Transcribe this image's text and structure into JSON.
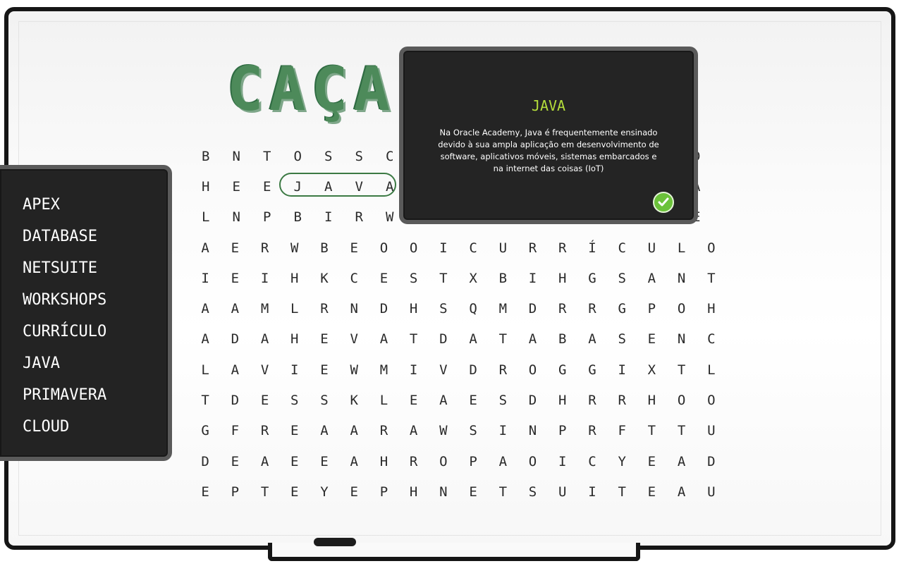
{
  "title": [
    "C",
    "A",
    "Ç",
    "A",
    "-"
  ],
  "menu": {
    "items": [
      {
        "label": "APEX"
      },
      {
        "label": "DATABASE"
      },
      {
        "label": "NETSUITE"
      },
      {
        "label": "WORKSHOPS"
      },
      {
        "label": "CURRÍCULO"
      },
      {
        "label": "JAVA"
      },
      {
        "label": "PRIMAVERA"
      },
      {
        "label": "CLOUD"
      }
    ]
  },
  "popup": {
    "title": "JAVA",
    "text": "Na Oracle Academy, Java é frequentemente ensinado devido à sua ampla aplicação em desenvolvimento de software, aplicativos móveis, sistemas embarcados e na internet das coisas (IoT)"
  },
  "grid": [
    [
      "B",
      "N",
      "T",
      "O",
      "S",
      "S",
      "C",
      "",
      "",
      "",
      "",
      "",
      "",
      "",
      "",
      "",
      "D"
    ],
    [
      "H",
      "E",
      "E",
      "J",
      "A",
      "V",
      "A",
      "",
      "",
      "",
      "",
      "",
      "",
      "",
      "",
      "",
      "A"
    ],
    [
      "L",
      "N",
      "P",
      "B",
      "I",
      "R",
      "W",
      "",
      "",
      "",
      "",
      "",
      "",
      "",
      "",
      "",
      "E"
    ],
    [
      "A",
      "E",
      "R",
      "W",
      "B",
      "E",
      "O",
      "O",
      "I",
      "C",
      "U",
      "R",
      "R",
      "Í",
      "C",
      "U",
      "L",
      "O"
    ],
    [
      "I",
      "E",
      "I",
      "H",
      "K",
      "C",
      "E",
      "S",
      "T",
      "X",
      "B",
      "I",
      "H",
      "G",
      "S",
      "A",
      "N",
      "T"
    ],
    [
      "A",
      "A",
      "M",
      "L",
      "R",
      "N",
      "D",
      "H",
      "S",
      "Q",
      "M",
      "D",
      "R",
      "R",
      "G",
      "P",
      "O",
      "H"
    ],
    [
      "A",
      "D",
      "A",
      "H",
      "E",
      "V",
      "A",
      "T",
      "D",
      "A",
      "T",
      "A",
      "B",
      "A",
      "S",
      "E",
      "N",
      "C"
    ],
    [
      "L",
      "A",
      "V",
      "I",
      "E",
      "W",
      "M",
      "I",
      "V",
      "D",
      "R",
      "O",
      "G",
      "G",
      "I",
      "X",
      "T",
      "L"
    ],
    [
      "T",
      "D",
      "E",
      "S",
      "S",
      "K",
      "L",
      "E",
      "A",
      "E",
      "S",
      "D",
      "H",
      "R",
      "R",
      "H",
      "O",
      "O"
    ],
    [
      "G",
      "F",
      "R",
      "E",
      "A",
      "A",
      "R",
      "A",
      "W",
      "S",
      "I",
      "N",
      "P",
      "R",
      "F",
      "T",
      "T",
      "U"
    ],
    [
      "D",
      "E",
      "A",
      "E",
      "E",
      "A",
      "H",
      "R",
      "O",
      "P",
      "A",
      "O",
      "I",
      "C",
      "Y",
      "E",
      "A",
      "D"
    ],
    [
      "E",
      "P",
      "T",
      "E",
      "Y",
      "E",
      "P",
      "H",
      "N",
      "E",
      "T",
      "S",
      "U",
      "I",
      "T",
      "E",
      "A",
      "U"
    ]
  ],
  "colors": {
    "accent": "#b4dd3b",
    "highlight": "#3c7a44",
    "check": "#6bc23a"
  },
  "icons": {
    "check": "check-circle-icon"
  }
}
